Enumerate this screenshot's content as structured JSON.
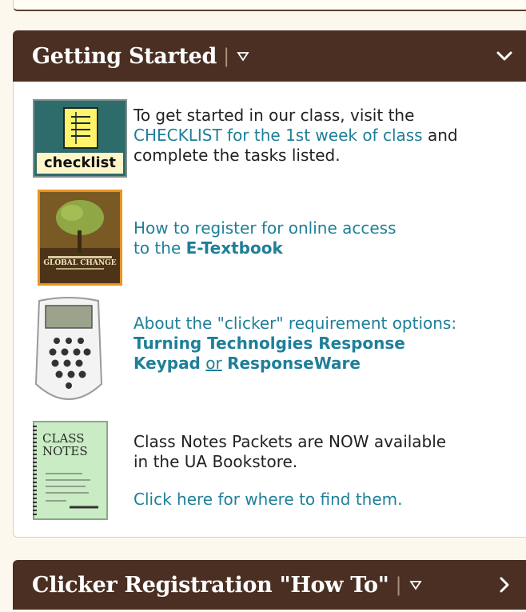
{
  "getting_started": {
    "title": "Getting Started",
    "items": [
      {
        "thumb_label": "checklist",
        "text_before": "To get started in our class, visit the ",
        "link_text": "CHECKLIST for the 1st week of class",
        "text_after": " and complete the tasks listed."
      },
      {
        "link_text": "How to register for online access to  the ",
        "link_bold": "E-Textbook",
        "book_title": "GLOBAL CHANGE"
      },
      {
        "link_text": "About the \"clicker\" requirement options:",
        "bold_link_1": "Turning Technolgies Response Keypad",
        "or_text": "or",
        "bold_link_2": "ResponseWare"
      },
      {
        "text": "Class Notes Packets are NOW available in the UA Bookstore.",
        "link_text": "Click here for where to find them.",
        "thumb_title": "CLASS NOTES"
      }
    ]
  },
  "clicker_registration": {
    "title": "Clicker Registration \"How To\""
  }
}
